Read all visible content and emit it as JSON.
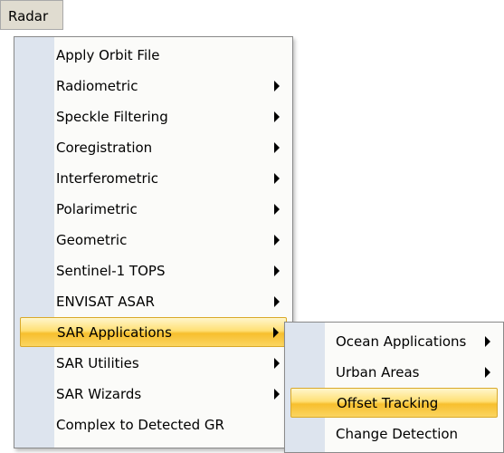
{
  "menubar": {
    "radar_label": "Radar"
  },
  "radar_menu": {
    "items": [
      {
        "label": "Apply Orbit File",
        "submenu": false
      },
      {
        "label": "Radiometric",
        "submenu": true
      },
      {
        "label": "Speckle Filtering",
        "submenu": true
      },
      {
        "label": "Coregistration",
        "submenu": true
      },
      {
        "label": "Interferometric",
        "submenu": true
      },
      {
        "label": "Polarimetric",
        "submenu": true
      },
      {
        "label": "Geometric",
        "submenu": true
      },
      {
        "label": "Sentinel-1 TOPS",
        "submenu": true
      },
      {
        "label": "ENVISAT ASAR",
        "submenu": true
      },
      {
        "label": "SAR Applications",
        "submenu": true,
        "highlighted": true
      },
      {
        "label": "SAR Utilities",
        "submenu": true
      },
      {
        "label": "SAR Wizards",
        "submenu": true
      },
      {
        "label": "Complex to Detected GR",
        "submenu": false
      }
    ]
  },
  "sar_applications_menu": {
    "items": [
      {
        "label": "Ocean Applications",
        "submenu": true
      },
      {
        "label": "Urban Areas",
        "submenu": true
      },
      {
        "label": "Offset Tracking",
        "submenu": false,
        "highlighted": true
      },
      {
        "label": "Change Detection",
        "submenu": false
      }
    ]
  },
  "colors": {
    "menubar_bg": "#e0dcd0",
    "menu_bg": "#fbfbf9",
    "gutter": "#dde4ee",
    "highlight": "#f7bf2e"
  }
}
